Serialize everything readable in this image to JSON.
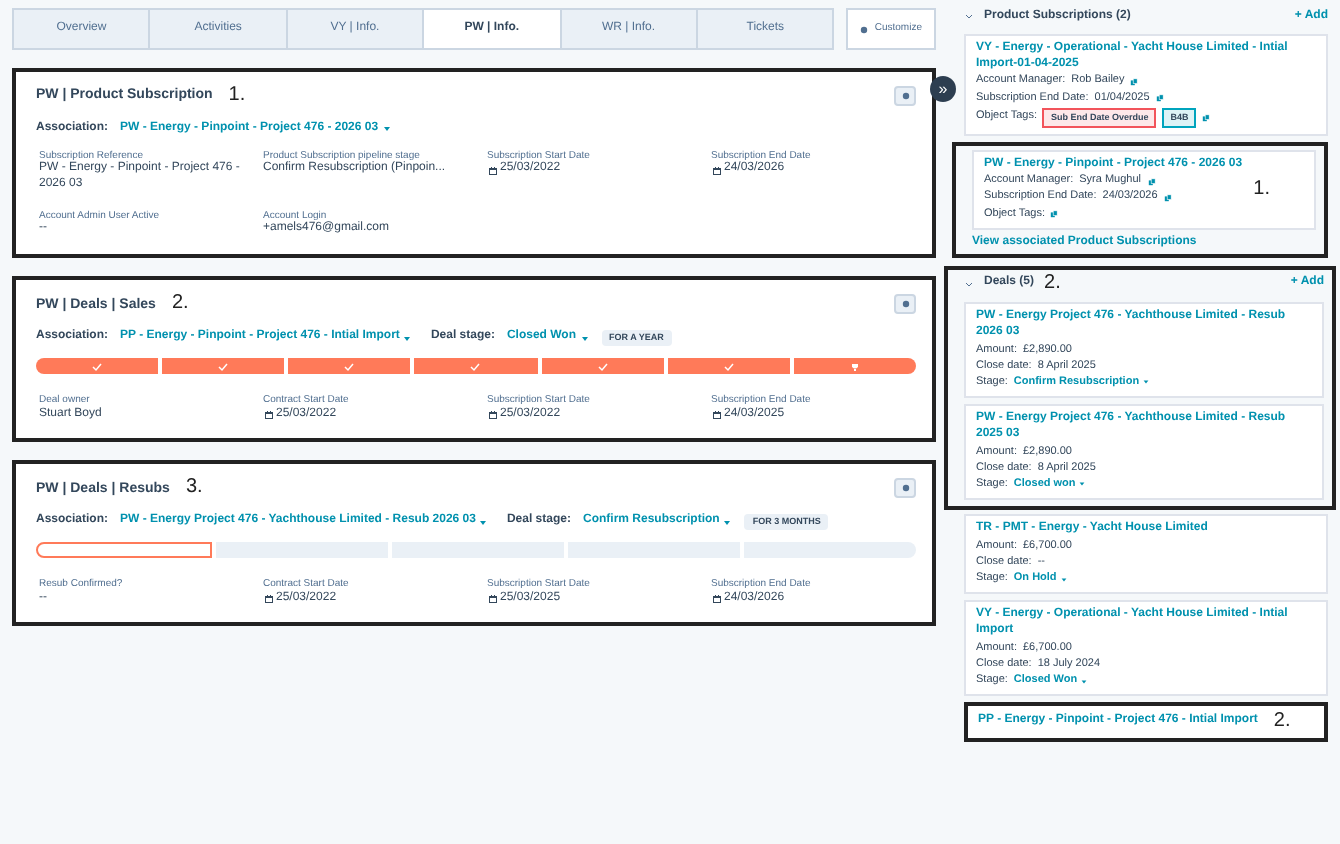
{
  "tabs": [
    {
      "label": "Overview",
      "selected": false
    },
    {
      "label": "Activities",
      "selected": false
    },
    {
      "label": "VY | Info.",
      "selected": false
    },
    {
      "label": "PW | Info.",
      "selected": true
    },
    {
      "label": "WR | Info.",
      "selected": false
    },
    {
      "label": "Tickets",
      "selected": false
    }
  ],
  "customize_button": "Customize",
  "cards": [
    {
      "title": "PW | Product Subscription",
      "annotation": "1.",
      "highlighted": true,
      "association_label": "Association:",
      "association": "PW - Energy - Pinpoint - Project 476 - 2026 03",
      "fields": [
        {
          "label": "Subscription Reference",
          "value": "PW - Energy - Pinpoint - Project 476 - 2026 03",
          "kind": "text"
        },
        {
          "label": "Product Subscription pipeline stage",
          "value": "Confirm Resubscription (Pinpoin...",
          "kind": "text"
        },
        {
          "label": "Subscription Start Date",
          "value": "25/03/2022",
          "kind": "date"
        },
        {
          "label": "Subscription End Date",
          "value": "24/03/2026",
          "kind": "date"
        },
        {
          "label": "Account Admin User Active",
          "value": "--",
          "kind": "text"
        },
        {
          "label": "Account Login",
          "value": "+amels476@gmail.com",
          "kind": "text"
        }
      ]
    },
    {
      "title": "PW | Deals | Sales",
      "annotation": "2.",
      "highlighted": true,
      "association_label": "Association:",
      "association": "PP - Energy - Pinpoint - Project 476 - Intial Import",
      "deal_stage_label": "Deal stage:",
      "deal_stage": "Closed Won",
      "stage_badge": "FOR A YEAR",
      "pipeline": [
        {
          "completed": true,
          "current": false,
          "kind": "check"
        },
        {
          "completed": true,
          "current": false,
          "kind": "check"
        },
        {
          "completed": true,
          "current": false,
          "kind": "check"
        },
        {
          "completed": true,
          "current": false,
          "kind": "check"
        },
        {
          "completed": true,
          "current": false,
          "kind": "check"
        },
        {
          "completed": true,
          "current": false,
          "kind": "check"
        },
        {
          "completed": true,
          "current": false,
          "kind": "won"
        }
      ],
      "fields": [
        {
          "label": "Deal owner",
          "value": "Stuart Boyd",
          "kind": "text"
        },
        {
          "label": "Contract Start Date",
          "value": "25/03/2022",
          "kind": "date"
        },
        {
          "label": "Subscription Start Date",
          "value": "25/03/2022",
          "kind": "date"
        },
        {
          "label": "Subscription End Date",
          "value": "24/03/2025",
          "kind": "date"
        }
      ]
    },
    {
      "title": "PW | Deals | Resubs",
      "annotation": "3.",
      "highlighted": true,
      "association_label": "Association:",
      "association": "PW - Energy Project 476 - Yachthouse Limited - Resub 2026 03",
      "deal_stage_label": "Deal stage:",
      "deal_stage": "Confirm Resubscription",
      "stage_badge": "FOR 3 MONTHS",
      "pipeline": [
        {
          "completed": false,
          "current": true
        },
        {
          "completed": false,
          "current": false
        },
        {
          "completed": false,
          "current": false
        },
        {
          "completed": false,
          "current": false
        },
        {
          "completed": false,
          "current": false
        }
      ],
      "fields": [
        {
          "label": "Resub Confirmed?",
          "value": "--",
          "kind": "text"
        },
        {
          "label": "Contract Start Date",
          "value": "25/03/2022",
          "kind": "date"
        },
        {
          "label": "Subscription Start Date",
          "value": "25/03/2025",
          "kind": "date"
        },
        {
          "label": "Subscription End Date",
          "value": "24/03/2026",
          "kind": "date"
        }
      ]
    }
  ],
  "sidebar": {
    "collapse_button": "»",
    "subscriptions": {
      "title": "Product Subscriptions (2)",
      "expanded": true,
      "add": "+ Add",
      "items": [
        {
          "title": "VY - Energy - Operational - Yacht House Limited - Intial Import-01-04-2025",
          "highlighted": false,
          "manager_label": "Account Manager:",
          "manager": "Rob Bailey",
          "end_label": "Subscription End Date:",
          "end": "01/04/2025",
          "tags_label": "Object Tags:",
          "tags": [
            {
              "label": "Sub End Date Overdue",
              "color": "#f2545b"
            },
            {
              "label": "B4B",
              "color": "#00a4bd"
            }
          ]
        },
        {
          "title": "PW - Energy - Pinpoint - Project 476 - 2026 03",
          "highlighted": true,
          "annotation": "1.",
          "manager_label": "Account Manager:",
          "manager": "Syra Mughul",
          "end_label": "Subscription End Date:",
          "end": "24/03/2026",
          "tags_label": "Object Tags:"
        }
      ],
      "view_link": "View associated Product Subscriptions"
    },
    "deals": {
      "title": "Deals (5)",
      "annotation": "2.",
      "highlighted": true,
      "expanded": true,
      "add": "+ Add",
      "items": [
        {
          "title": "PW - Energy Project 476 - Yachthouse Limited - Resub 2026 03",
          "highlighted": true,
          "amount_label": "Amount:",
          "amount": "£2,890.00",
          "close_label": "Close date:",
          "close": "8 April 2025",
          "stage_label": "Stage:",
          "stage": "Confirm Resubscription"
        },
        {
          "title": "PW - Energy Project 476 - Yachthouse Limited - Resub 2025 03",
          "highlighted": true,
          "amount_label": "Amount:",
          "amount": "£2,890.00",
          "close_label": "Close date:",
          "close": "8 April 2025",
          "stage_label": "Stage:",
          "stage": "Closed won"
        },
        {
          "title": "TR - PMT - Energy - Yacht House Limited",
          "highlighted": false,
          "amount_label": "Amount:",
          "amount": "£6,700.00",
          "close_label": "Close date:",
          "close": "--",
          "stage_label": "Stage:",
          "stage": "On Hold"
        },
        {
          "title": "VY - Energy - Operational - Yacht House Limited - Intial Import",
          "highlighted": false,
          "amount_label": "Amount:",
          "amount": "£6,700.00",
          "close_label": "Close date:",
          "close": "18 July 2024",
          "stage_label": "Stage:",
          "stage": "Closed Won"
        },
        {
          "title": "PP - Energy - Pinpoint - Project 476 - Intial Import",
          "highlighted": true,
          "annotation": "2."
        }
      ]
    }
  }
}
